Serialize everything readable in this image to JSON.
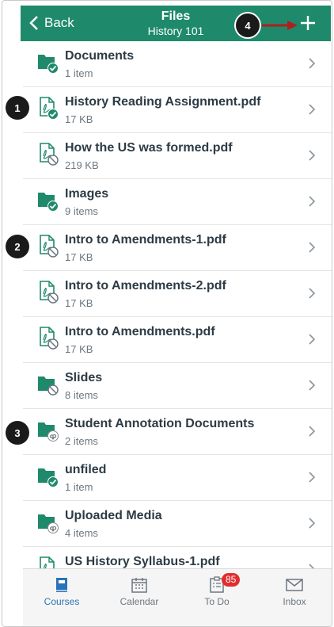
{
  "header": {
    "back_label": "Back",
    "title": "Files",
    "subtitle": "History 101"
  },
  "callouts": [
    "1",
    "2",
    "3",
    "4"
  ],
  "files": [
    {
      "name": "Documents",
      "meta": "1 item",
      "kind": "folder",
      "status": "published"
    },
    {
      "name": "History Reading Assignment.pdf",
      "meta": "17 KB",
      "kind": "pdf",
      "status": "published"
    },
    {
      "name": "How the US was formed.pdf",
      "meta": "219 KB",
      "kind": "pdf",
      "status": "unpublished"
    },
    {
      "name": "Images",
      "meta": "9 items",
      "kind": "folder",
      "status": "published"
    },
    {
      "name": "Intro to Amendments-1.pdf",
      "meta": "17 KB",
      "kind": "pdf",
      "status": "unpublished"
    },
    {
      "name": "Intro to Amendments-2.pdf",
      "meta": "17 KB",
      "kind": "pdf",
      "status": "unpublished"
    },
    {
      "name": "Intro to Amendments.pdf",
      "meta": "17 KB",
      "kind": "pdf",
      "status": "unpublished"
    },
    {
      "name": "Slides",
      "meta": "8 items",
      "kind": "folder",
      "status": "unpublished"
    },
    {
      "name": "Student Annotation Documents",
      "meta": "2 items",
      "kind": "folder",
      "status": "hidden"
    },
    {
      "name": "unfiled",
      "meta": "1 item",
      "kind": "folder",
      "status": "published"
    },
    {
      "name": "Uploaded Media",
      "meta": "4 items",
      "kind": "folder",
      "status": "hidden"
    },
    {
      "name": "US History Syllabus-1.pdf",
      "meta": "",
      "kind": "pdf",
      "status": "unpublished"
    }
  ],
  "tabs": [
    {
      "label": "Courses",
      "icon": "courses-icon",
      "active": true
    },
    {
      "label": "Calendar",
      "icon": "calendar-icon",
      "active": false
    },
    {
      "label": "To Do",
      "icon": "todo-icon",
      "active": false,
      "badge": "85"
    },
    {
      "label": "Inbox",
      "icon": "inbox-icon",
      "active": false
    }
  ],
  "colors": {
    "brand": "#1f8a6b",
    "active_tab": "#2b72b8",
    "badge": "#e02d2d",
    "callout_arrow": "#b01e1e"
  }
}
